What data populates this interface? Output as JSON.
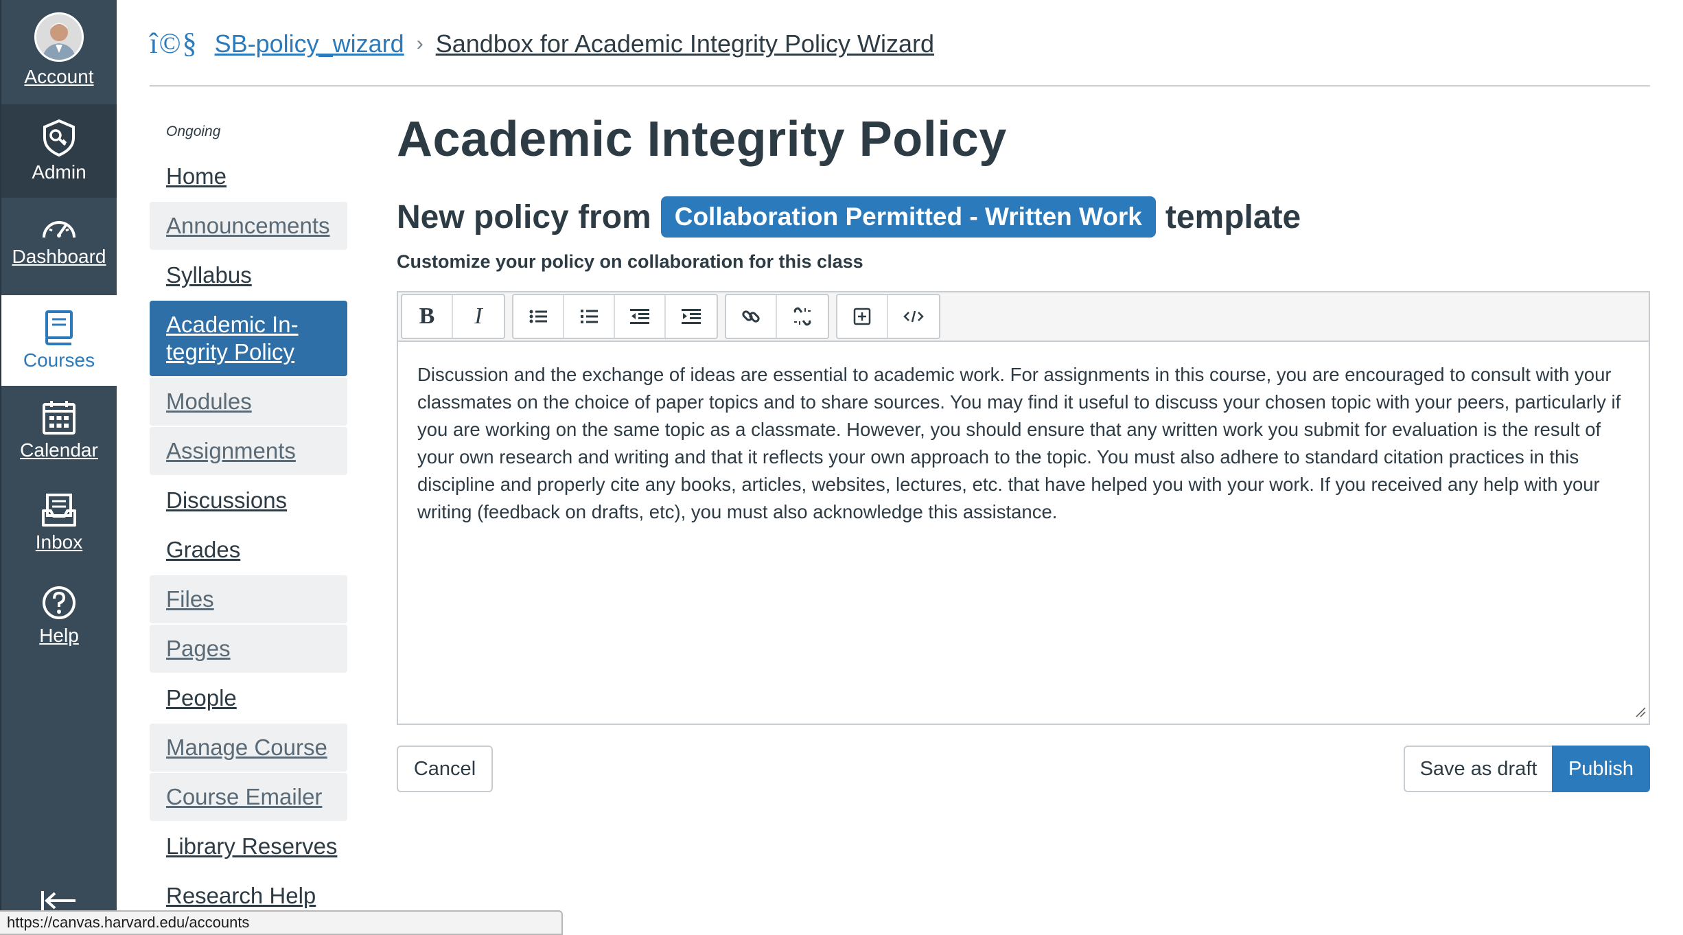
{
  "global_nav": {
    "items": [
      {
        "label": "Account",
        "icon": "avatar"
      },
      {
        "label": "Admin",
        "icon": "admin-shield-icon"
      },
      {
        "label": "Dashboard",
        "icon": "dashboard-gauge-icon"
      },
      {
        "label": "Courses",
        "icon": "courses-book-icon"
      },
      {
        "label": "Calendar",
        "icon": "calendar-icon"
      },
      {
        "label": "Inbox",
        "icon": "inbox-icon"
      },
      {
        "label": "Help",
        "icon": "help-icon"
      }
    ],
    "collapse_icon": "collapse-arrow-icon"
  },
  "breadcrumb": {
    "logo_text": "î©§",
    "course": "SB-policy_wizard",
    "separator": "›",
    "page": "Sandbox for Academic Integrity Policy Wizard"
  },
  "course_nav": {
    "term": "Ongoing",
    "items": [
      {
        "label": "Home"
      },
      {
        "label": "Announcements"
      },
      {
        "label": "Syllabus"
      },
      {
        "label": "Academic In-tegrity Policy"
      },
      {
        "label": "Modules"
      },
      {
        "label": "Assignments"
      },
      {
        "label": "Discussions"
      },
      {
        "label": "Grades"
      },
      {
        "label": "Files"
      },
      {
        "label": "Pages"
      },
      {
        "label": "People"
      },
      {
        "label": "Manage Course"
      },
      {
        "label": "Course Emailer"
      },
      {
        "label": "Library Reserves"
      },
      {
        "label": "Research Help"
      }
    ]
  },
  "main": {
    "title": "Academic Integrity Policy",
    "subtitle_prefix": "New policy from",
    "template_name": "Collaboration Permitted - Written Work",
    "subtitle_suffix": "template",
    "instructions": "Customize your policy on collaboration for this class"
  },
  "editor": {
    "toolbar": [
      "bold",
      "italic",
      "bullet-list",
      "numbered-list",
      "outdent",
      "indent",
      "link",
      "unlink",
      "embed",
      "html-editor"
    ],
    "bold_glyph": "B",
    "italic_glyph": "I",
    "body": "Discussion and the exchange of ideas are essential to academic work. For assignments in this course, you are encouraged to consult with your classmates on the choice of paper topics and to share sources. You may find it useful to discuss your chosen topic with your peers, particularly if you are working on the same topic as a classmate. However, you should ensure that any written work you submit for evaluation is the result of your own research and writing and that it reflects your own approach to the topic. You must also adhere to standard citation practices in this discipline and properly cite any books, articles, websites, lectures, etc. that have helped you with your work. If you received any help with your writing (feedback on drafts, etc), you must also acknowledge this assistance."
  },
  "actions": {
    "cancel": "Cancel",
    "save_draft": "Save as draft",
    "publish": "Publish"
  },
  "status_bar": {
    "url": "https://canvas.harvard.edu/accounts"
  },
  "colors": {
    "nav_bg": "#394b58",
    "accent": "#2b7abc",
    "active_nav": "#2d6fa6"
  }
}
